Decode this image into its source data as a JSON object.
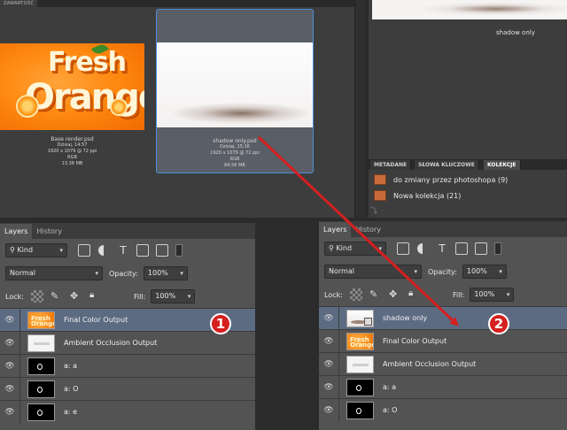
{
  "content": {
    "tab_label": "ZAWARTOŚĆ",
    "items": [
      {
        "name": "Base render.psd",
        "date": "Dzisiaj, 14:57",
        "dims": "1920 x 1079 @ 72 ppi",
        "mode": "RGB",
        "size": "13.38 MB"
      },
      {
        "name": "shadow only.psd",
        "date": "Dzisiaj, 15:16",
        "dims": "1920 x 1079 @ 72 ppi",
        "mode": "RGB",
        "size": "84.56 MB"
      }
    ],
    "thumb_text": {
      "line1": "Fresh",
      "line2": "Orange"
    }
  },
  "preview": {
    "caption": "shadow only"
  },
  "keywords_panel": {
    "tabs": [
      "METADANE",
      "SŁOWA KLUCZOWE",
      "KOLEKCJE"
    ],
    "active_tab": "KOLEKCJE",
    "collections": [
      {
        "label": "do zmiany przez photoshopa (9)"
      },
      {
        "label": "Nowa kolekcja (21)"
      }
    ],
    "footer_icon": "⤵"
  },
  "layers_left": {
    "tabs": [
      "Layers",
      "History"
    ],
    "filter": "Kind",
    "blend": "Normal",
    "opacity_label": "Opacity:",
    "opacity": "100%",
    "lock_label": "Lock:",
    "fill_label": "Fill:",
    "fill": "100%",
    "layers": [
      {
        "name": "Final Color Output",
        "thumb": "orange",
        "selected": true
      },
      {
        "name": "Ambient Occlusion Output",
        "thumb": "white"
      },
      {
        "name": "a: a",
        "thumb": "black"
      },
      {
        "name": "a: O",
        "thumb": "black"
      },
      {
        "name": "a: e",
        "thumb": "black"
      }
    ],
    "badge": "1"
  },
  "layers_right": {
    "tabs": [
      "Layers",
      "History"
    ],
    "filter": "Kind",
    "blend": "Normal",
    "opacity_label": "Opacity:",
    "opacity": "100%",
    "lock_label": "Lock:",
    "fill_label": "Fill:",
    "fill": "100%",
    "layers": [
      {
        "name": "shadow only",
        "thumb": "smart",
        "selected": true
      },
      {
        "name": "Final Color Output",
        "thumb": "orange"
      },
      {
        "name": "Ambient Occlusion Output",
        "thumb": "white"
      },
      {
        "name": "a: a",
        "thumb": "black"
      },
      {
        "name": "a: O",
        "thumb": "black"
      }
    ],
    "badge": "2"
  },
  "colors": {
    "arrow": "#d61f1f",
    "selection": "#4a8fd8",
    "badge": "#d62020"
  }
}
